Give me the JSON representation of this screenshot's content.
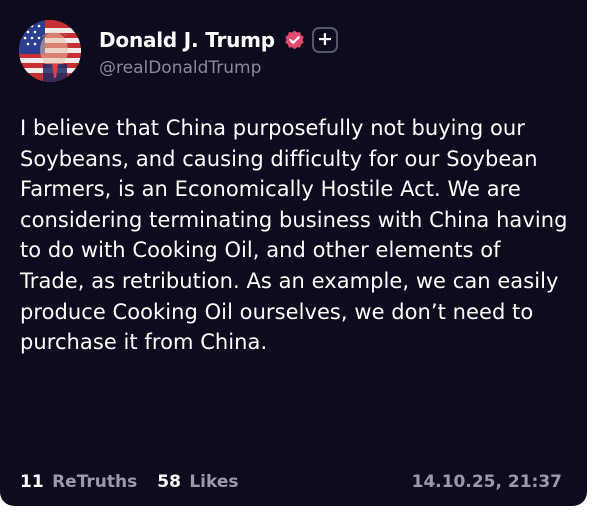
{
  "post": {
    "author": {
      "display_name": "Donald J. Trump",
      "handle": "@realDonaldTrump",
      "avatar_icon": "american-flag-portrait-avatar",
      "verified_icon": "verified-badge-icon",
      "verified_color": "#e24a6e",
      "follow_icon": "plus-icon"
    },
    "text": "I believe that China purposefully not buying our Soybeans, and causing difficulty for our Soybean Farmers, is an Economically Hostile Act. We are considering terminating business with China having to do with Cooking Oil, and other elements of Trade, as retribution. As an example, we can easily produce Cooking Oil ourselves, we don’t need to purchase it from China.",
    "stats": {
      "retruths_count": "11",
      "retruths_label": "ReTruths",
      "likes_count": "58",
      "likes_label": "Likes"
    },
    "timestamp": "14.10.25, 21:37"
  },
  "colors": {
    "background": "#0d0c1e",
    "text": "#ffffff",
    "muted": "#8a8a9a"
  }
}
